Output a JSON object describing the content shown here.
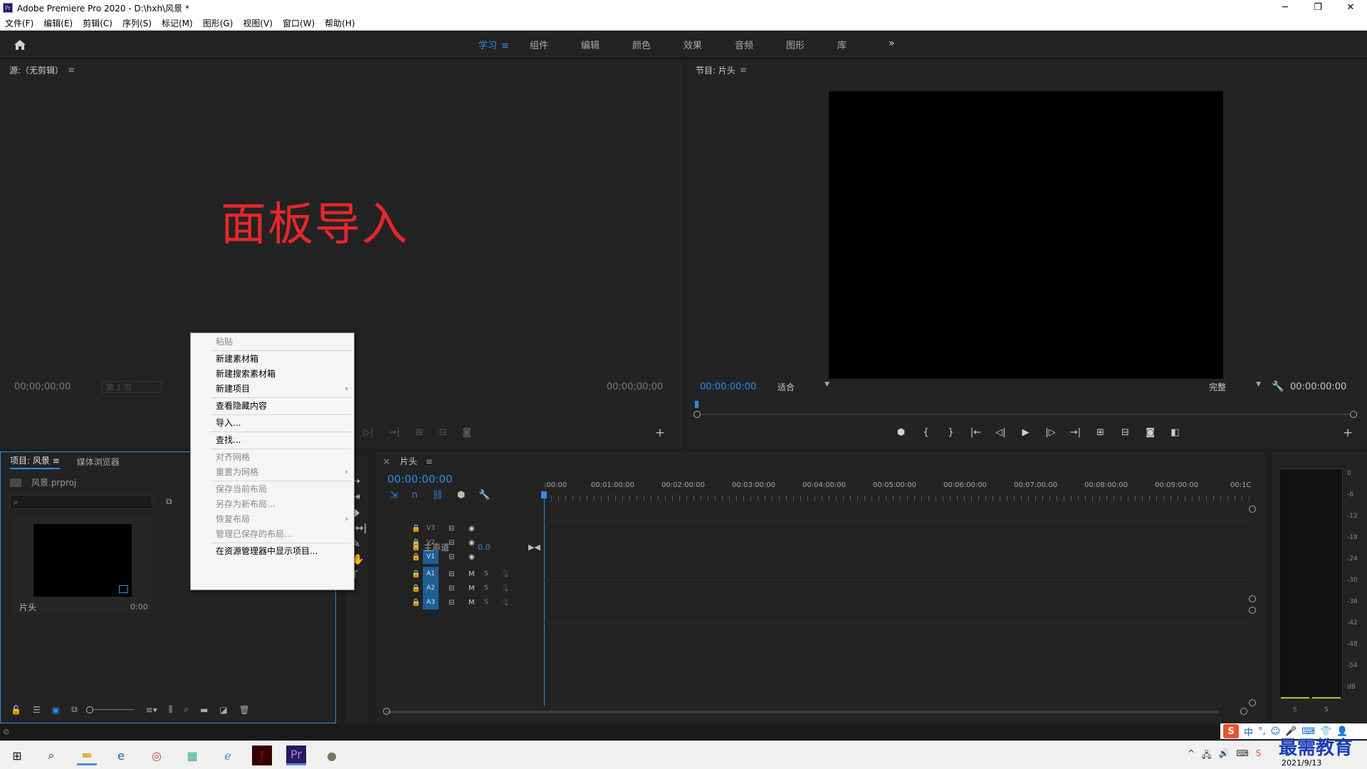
{
  "window": {
    "logo_text": "Pr",
    "title": "Adobe Premiere Pro 2020 - D:\\hxh\\风景 *",
    "controls": [
      "─",
      "❐",
      "✕"
    ]
  },
  "menubar": [
    "文件(F)",
    "编辑(E)",
    "剪辑(C)",
    "序列(S)",
    "标记(M)",
    "图形(G)",
    "视图(V)",
    "窗口(W)",
    "帮助(H)"
  ],
  "workspaces": {
    "tabs": [
      "学习",
      "组件",
      "编辑",
      "颜色",
      "效果",
      "音频",
      "图形",
      "库"
    ],
    "active_index": 0,
    "more": "»"
  },
  "source_panel": {
    "title": "源:（无剪辑）",
    "menu_icon": "≡",
    "overlay_text": "面板导入",
    "timecode_left": "00;00;00;00",
    "page_select": "第 1 页",
    "timecode_right": "00;00;00;00"
  },
  "program_panel": {
    "title": "节目: 片头",
    "menu_icon": "≡",
    "timecode": "00:00:00:00",
    "fit_select": "适合",
    "quality_select": "完整",
    "timecode_right": "00:00:00:00",
    "add": "+"
  },
  "project_panel": {
    "tab_active": "项目: 风景",
    "tab_menu": "≡",
    "tab_other": "媒体浏览器",
    "file_name": "风景.prproj",
    "clip_name": "片头",
    "clip_duration": "0:00"
  },
  "context_menu": {
    "items": [
      {
        "label": "粘贴",
        "disabled": true,
        "submenu": false
      },
      {
        "label": "新建素材箱",
        "disabled": false,
        "submenu": false
      },
      {
        "label": "新建搜索素材箱",
        "disabled": false,
        "submenu": false
      },
      {
        "label": "新建项目",
        "disabled": false,
        "submenu": true
      },
      {
        "label": "查看隐藏内容",
        "disabled": false,
        "submenu": false
      },
      {
        "label": "导入...",
        "disabled": false,
        "submenu": false
      },
      {
        "label": "查找...",
        "disabled": false,
        "submenu": false
      },
      {
        "label": "对齐网格",
        "disabled": true,
        "submenu": false
      },
      {
        "label": "重置为网格",
        "disabled": true,
        "submenu": true
      },
      {
        "label": "保存当前布局",
        "disabled": true,
        "submenu": false
      },
      {
        "label": "另存为新布局...",
        "disabled": true,
        "submenu": false
      },
      {
        "label": "恢复布局",
        "disabled": true,
        "submenu": true
      },
      {
        "label": "管理已保存的布局...",
        "disabled": true,
        "submenu": false
      },
      {
        "label": "在资源管理器中显示项目...",
        "disabled": false,
        "submenu": false
      }
    ],
    "submenu_arrow": "›"
  },
  "timeline": {
    "close": "×",
    "title": "片头",
    "menu_icon": "≡",
    "timecode": "00:00:00:00",
    "ruler_labels": [
      ":00:00",
      "00:01:00:00",
      "00:02:00:00",
      "00:03:00:00",
      "00:04:00:00",
      "00:05:00:00",
      "00:06:00:00",
      "00:07:00:00",
      "00:08:00:00",
      "00:09:00:00",
      "00:1C"
    ],
    "tracks": [
      {
        "name": "V3",
        "kind": "video",
        "targeted": false
      },
      {
        "name": "V2",
        "kind": "video",
        "targeted": false
      },
      {
        "name": "V1",
        "kind": "video",
        "targeted": true
      },
      {
        "name": "A1",
        "kind": "audio",
        "targeted": true
      },
      {
        "name": "A2",
        "kind": "audio",
        "targeted": true
      },
      {
        "name": "A3",
        "kind": "audio",
        "targeted": true
      }
    ],
    "audio_m": "M",
    "audio_s": "S",
    "master_label": "主声道",
    "master_value": "0.0"
  },
  "audio_meter": {
    "scale": [
      "0",
      "-6",
      "-12",
      "-18",
      "-24",
      "-30",
      "-36",
      "-42",
      "-48",
      "-54",
      "dB"
    ],
    "solo_labels": [
      "S",
      "S"
    ]
  },
  "taskbar": {
    "date": "2021/9/13"
  },
  "ime": {
    "logo": "S",
    "mode": "中"
  },
  "watermark": "最需教育",
  "colors": {
    "accent": "#2d8ceb",
    "overlay_red": "#e8262b",
    "panel_bg": "#232323",
    "track_target": "#1f5f94"
  }
}
